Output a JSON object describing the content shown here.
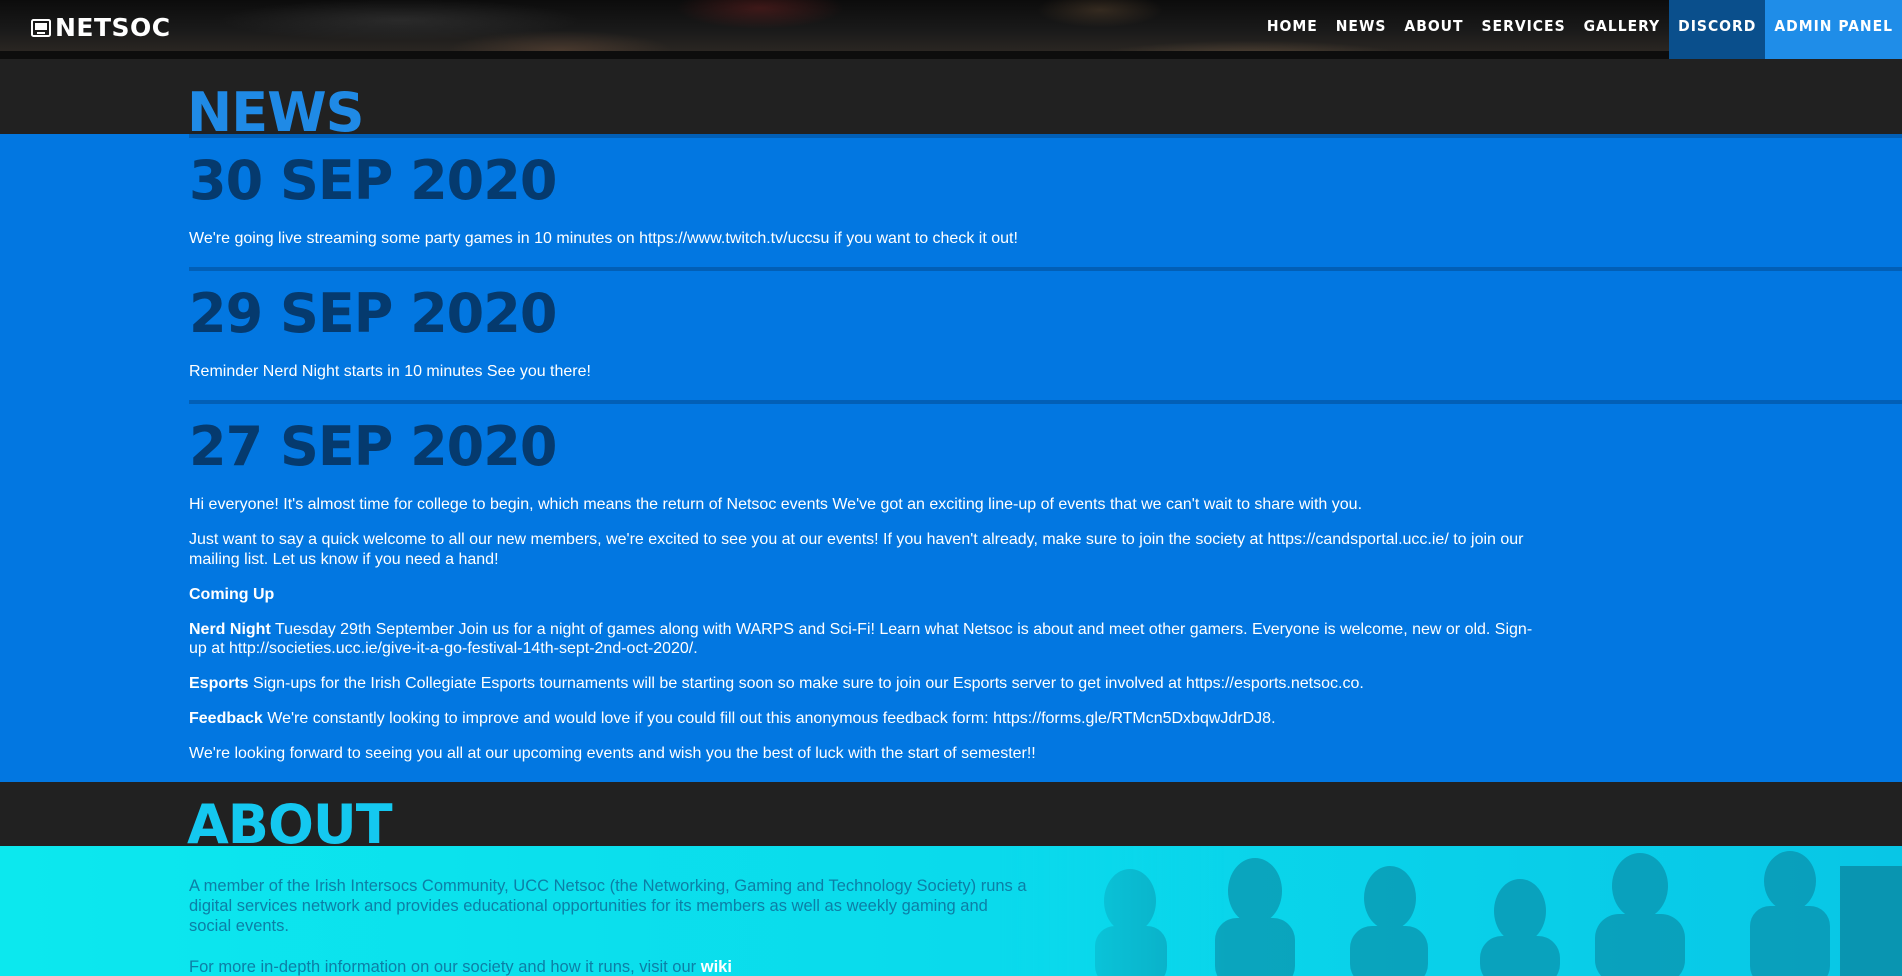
{
  "navbar": {
    "brand": "NETSOC",
    "links": [
      {
        "label": "HOME"
      },
      {
        "label": "NEWS"
      },
      {
        "label": "ABOUT"
      },
      {
        "label": "SERVICES"
      },
      {
        "label": "GALLERY"
      },
      {
        "label": "DISCORD"
      },
      {
        "label": "ADMIN PANEL"
      }
    ]
  },
  "news": {
    "title": "NEWS",
    "items": [
      {
        "date": "30 SEP 2020",
        "paragraphs": [
          "We're going live streaming some party games in 10 minutes on https://www.twitch.tv/uccsu if you want to check it out!"
        ]
      },
      {
        "date": "29 SEP 2020",
        "paragraphs": [
          "Reminder Nerd Night starts in 10 minutes See you there!"
        ]
      },
      {
        "date": "27 SEP 2020",
        "intro": "Hi everyone! It's almost time for college to begin, which means the return of Netsoc events We've got an exciting line-up of events that we can't wait to share with you.",
        "welcome": "Just want to say a quick welcome to all our new members, we're excited to see you at our events! If you haven't already, make sure to join the society at https://candsportal.ucc.ie/ to join our mailing list. Let us know if you need a hand!",
        "coming_up": "Coming Up",
        "nerd_night_label": "Nerd Night",
        "nerd_night_text": " Tuesday 29th September Join us for a night of games along with WARPS and Sci-Fi! Learn what Netsoc is about and meet other gamers. Everyone is welcome, new or old. Sign-up at http://societies.ucc.ie/give-it-a-go-festival-14th-sept-2nd-oct-2020/.",
        "esports_label": "Esports",
        "esports_text": " Sign-ups for the Irish Collegiate Esports tournaments will be starting soon so make sure to join our Esports server to get involved at https://esports.netsoc.co.",
        "feedback_label": "Feedback",
        "feedback_text": " We're constantly looking to improve and would love if you could fill out this anonymous feedback form: https://forms.gle/RTMcn5DxbqwJdrDJ8.",
        "closing": "We're looking forward to seeing you all at our upcoming events and wish you the best of luck with the start of semester!!"
      }
    ]
  },
  "about": {
    "title": "ABOUT",
    "paragraph": "A member of the Irish Intersocs Community, UCC Netsoc (the Networking, Gaming and Technology Society) runs a digital services network and provides educational opportunities for its members as well as weekly gaming and social events.",
    "more_prefix": "For more in-depth information on our society and how it runs, visit our ",
    "more_link": "wiki"
  },
  "icons": {
    "brand": "computer-logo-icon"
  },
  "colors": {
    "news_band": "#0277e1",
    "news_date": "#053a6e",
    "news_title": "#1f8ae6",
    "about_title": "#14c8f0",
    "discord_nav": "#0a4f8c",
    "admin_nav": "#1f8de8"
  }
}
